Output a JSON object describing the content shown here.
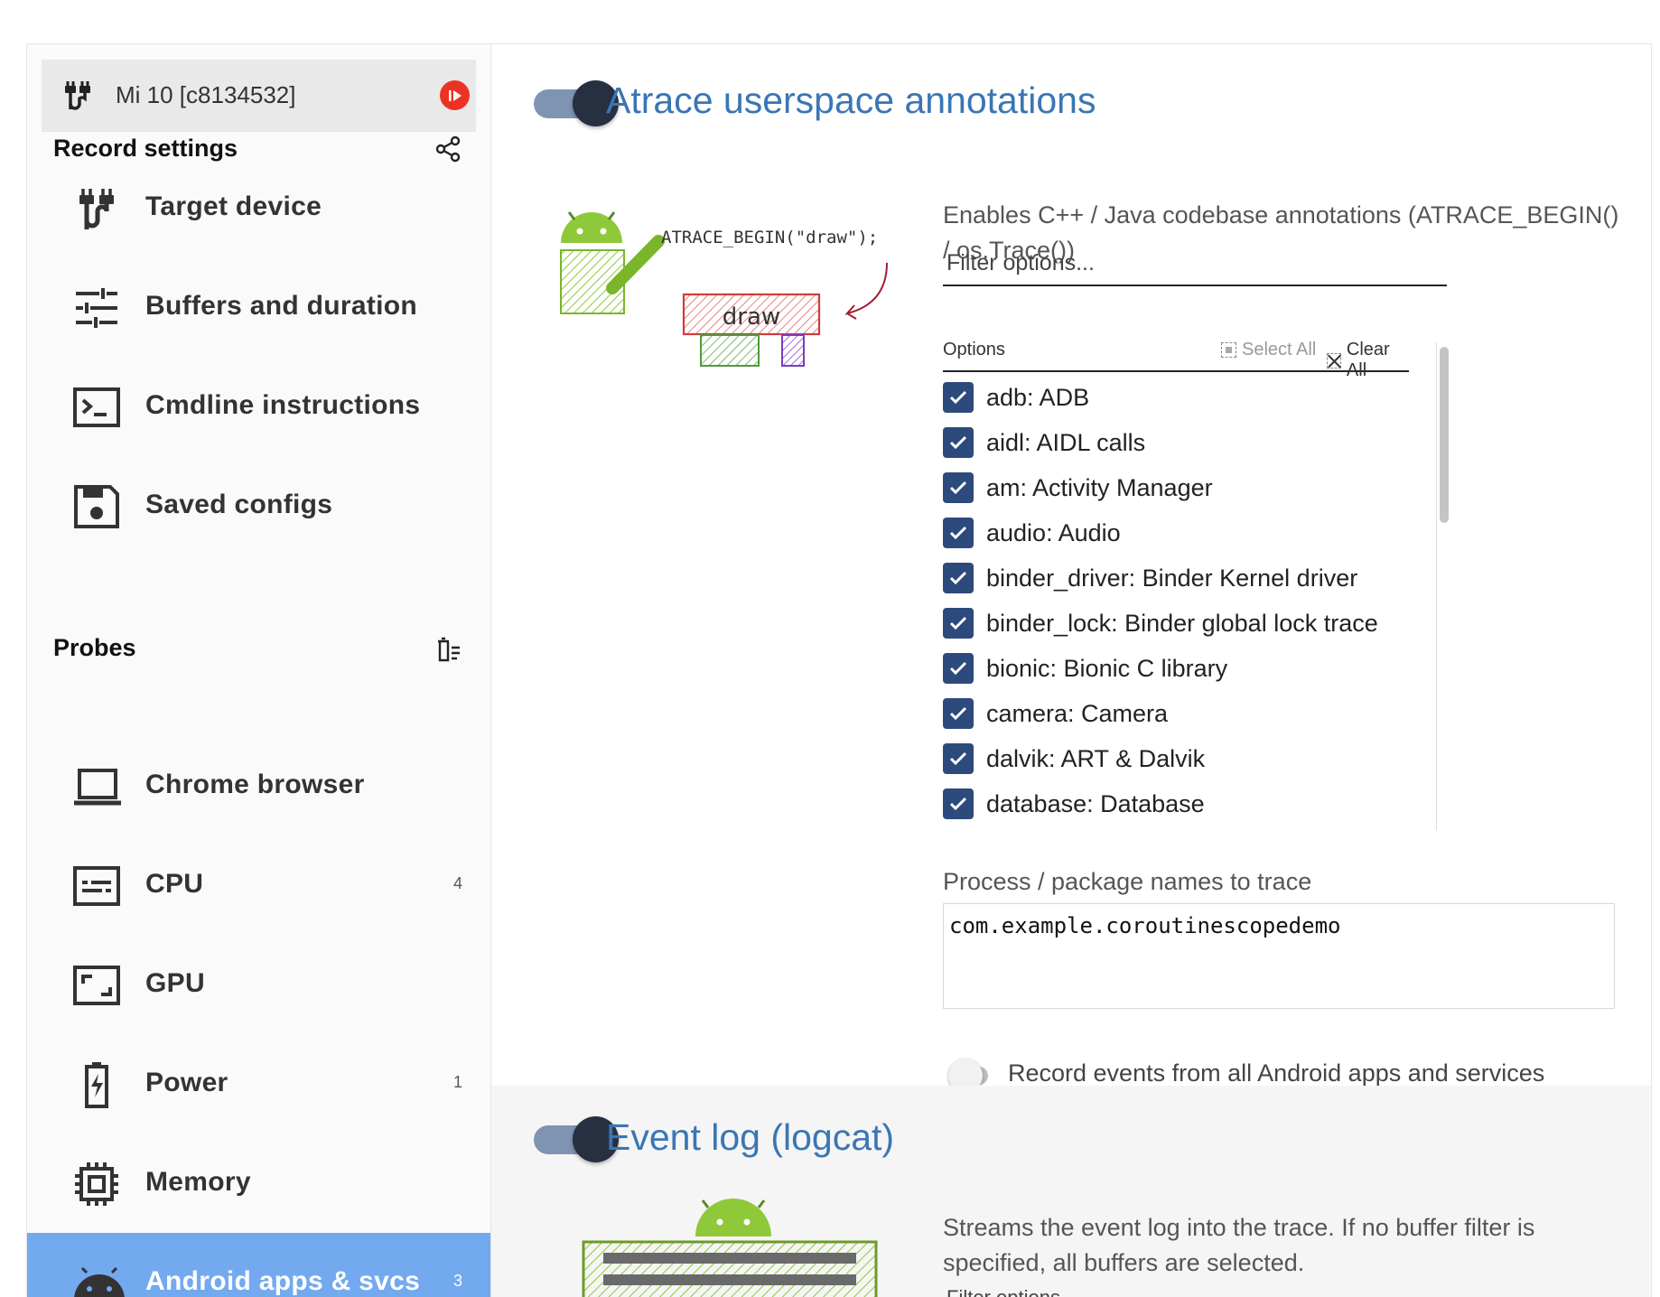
{
  "device": {
    "name": "Mi 10 [c8134532]"
  },
  "sidebar": {
    "record_settings_label": "Record settings",
    "probes_label": "Probes",
    "settings_items": [
      {
        "label": "Target device",
        "icon": "usb-icon"
      },
      {
        "label": "Buffers and duration",
        "icon": "tune-icon"
      },
      {
        "label": "Cmdline instructions",
        "icon": "terminal-icon"
      },
      {
        "label": "Saved configs",
        "icon": "save-icon"
      }
    ],
    "probe_items": [
      {
        "label": "Chrome browser",
        "icon": "laptop-icon",
        "count": ""
      },
      {
        "label": "CPU",
        "icon": "subtitles-icon",
        "count": "4"
      },
      {
        "label": "GPU",
        "icon": "aspect-ratio-icon",
        "count": ""
      },
      {
        "label": "Power",
        "icon": "battery-charging-icon",
        "count": "1"
      },
      {
        "label": "Memory",
        "icon": "memory-chip-icon",
        "count": ""
      },
      {
        "label": "Android apps & svcs",
        "icon": "android-icon",
        "count": "3",
        "active": true
      }
    ]
  },
  "atrace": {
    "title": "Atrace userspace annotations",
    "enabled": true,
    "description": "Enables C++ / Java codebase annotations (ATRACE_BEGIN() / os.Trace())",
    "illustration_code": "ATRACE_BEGIN(\"draw\");",
    "illustration_box": "draw",
    "filter_placeholder": "Filter options...",
    "options_header": "Options",
    "select_all": "Select All",
    "clear_all": "Clear All",
    "options": [
      "adb: ADB",
      "aidl: AIDL calls",
      "am: Activity Manager",
      "audio: Audio",
      "binder_driver: Binder Kernel driver",
      "binder_lock: Binder global lock trace",
      "bionic: Bionic C library",
      "camera: Camera",
      "dalvik: ART & Dalvik",
      "database: Database"
    ],
    "process_label": "Process / package names to trace",
    "process_value": "com.example.coroutinescopedemo",
    "record_all_label": "Record events from all Android apps and services",
    "record_all_enabled": false
  },
  "logcat": {
    "title": "Event log (logcat)",
    "enabled": true,
    "description": "Streams the event log into the trace. If no buffer filter is specified, all buffers are selected.",
    "filter_placeholder": "Filter options..."
  },
  "colors": {
    "accent_blue": "#3a76b4",
    "active_nav": "#73a9ee",
    "checkbox": "#2d4a7c",
    "record_red": "#ec3323"
  }
}
